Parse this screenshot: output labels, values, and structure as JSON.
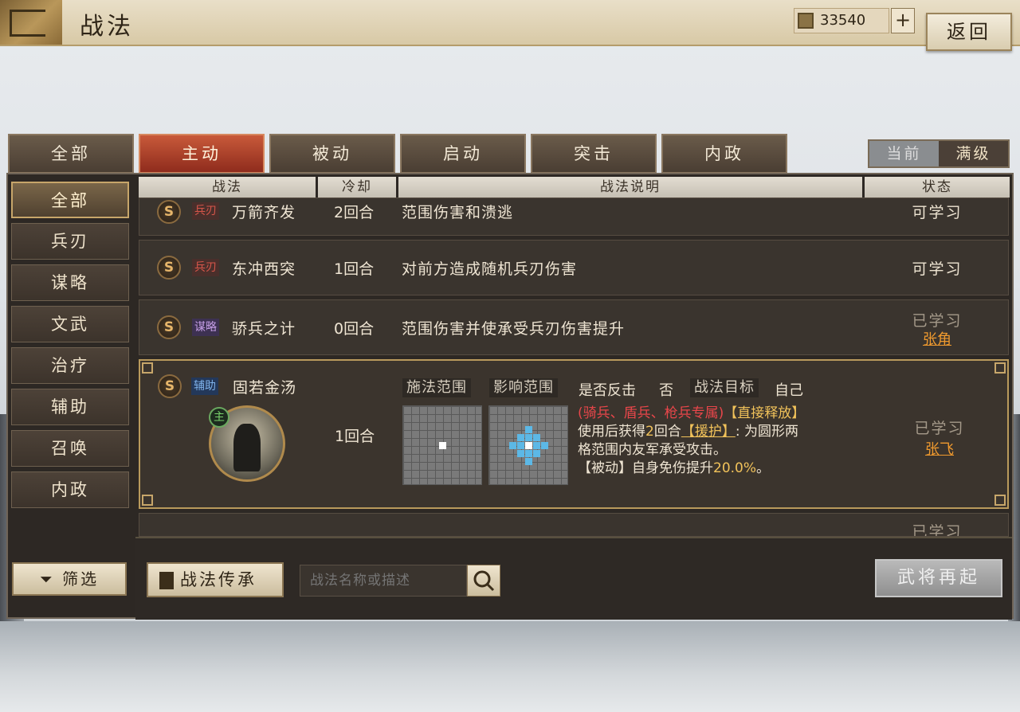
{
  "header": {
    "title": "战法",
    "currency_value": "33540",
    "add_label": "+",
    "back_label": "返回",
    "currency_icon": "gold-ingot-icon"
  },
  "tabs": [
    "全部",
    "主动",
    "被动",
    "启动",
    "突击",
    "内政"
  ],
  "active_tab": "主动",
  "level_toggle": {
    "current": "当前",
    "max": "满级",
    "selected": "满级"
  },
  "sidebar": {
    "items": [
      "全部",
      "兵刃",
      "谋略",
      "文武",
      "治疗",
      "辅助",
      "召唤",
      "内政"
    ],
    "active": "全部"
  },
  "table": {
    "columns": [
      "战法",
      "冷却",
      "战法说明",
      "状态"
    ],
    "rows": [
      {
        "grade": "S",
        "type": "兵刃",
        "name": "万箭齐发",
        "cooldown": "2回合",
        "description": "范围伤害和溃逃",
        "status": "可学习",
        "learner": ""
      },
      {
        "grade": "S",
        "type": "兵刃",
        "name": "东冲西突",
        "cooldown": "1回合",
        "description": "对前方造成随机兵刃伤害",
        "status": "可学习",
        "learner": ""
      },
      {
        "grade": "S",
        "type": "谋略",
        "name": "骄兵之计",
        "cooldown": "0回合",
        "description": "范围伤害并使承受兵刃伤害提升",
        "status": "已学习",
        "learner": "张角"
      }
    ],
    "selected": {
      "grade": "S",
      "type": "辅助",
      "name": "固若金汤",
      "cooldown": "1回合",
      "main_mark": "主",
      "cast_range_label": "施法范围",
      "effect_range_label": "影响范围",
      "counter_label": "是否反击",
      "counter_value": "否",
      "target_label": "战法目标",
      "target_value": "自己",
      "restriction": "(骑兵、盾兵、枪兵专属)",
      "release": "【直接释放】",
      "text1_pre": "使用后获得",
      "text1_num": "2",
      "text1_mid": "回合",
      "text1_buff": "【援护】",
      "text1_post": ": 为圆形两",
      "text2": "格范围内友军承受攻击。",
      "text3_pre": "【被动】自身免伤提升",
      "text3_num": "20.0%",
      "text3_post": "。",
      "status": "已学习",
      "learner": "张飞"
    },
    "partial_row": {
      "status": "已学习"
    }
  },
  "bottom": {
    "filter_label": "筛选",
    "inherit_label": "战法传承",
    "search_placeholder": "战法名称或描述",
    "rebirth_label": "武将再起"
  },
  "colors": {
    "accent_red": "#c8593a",
    "learned_gold": "#f09a2e",
    "range_blue": "#5cb8e6"
  }
}
